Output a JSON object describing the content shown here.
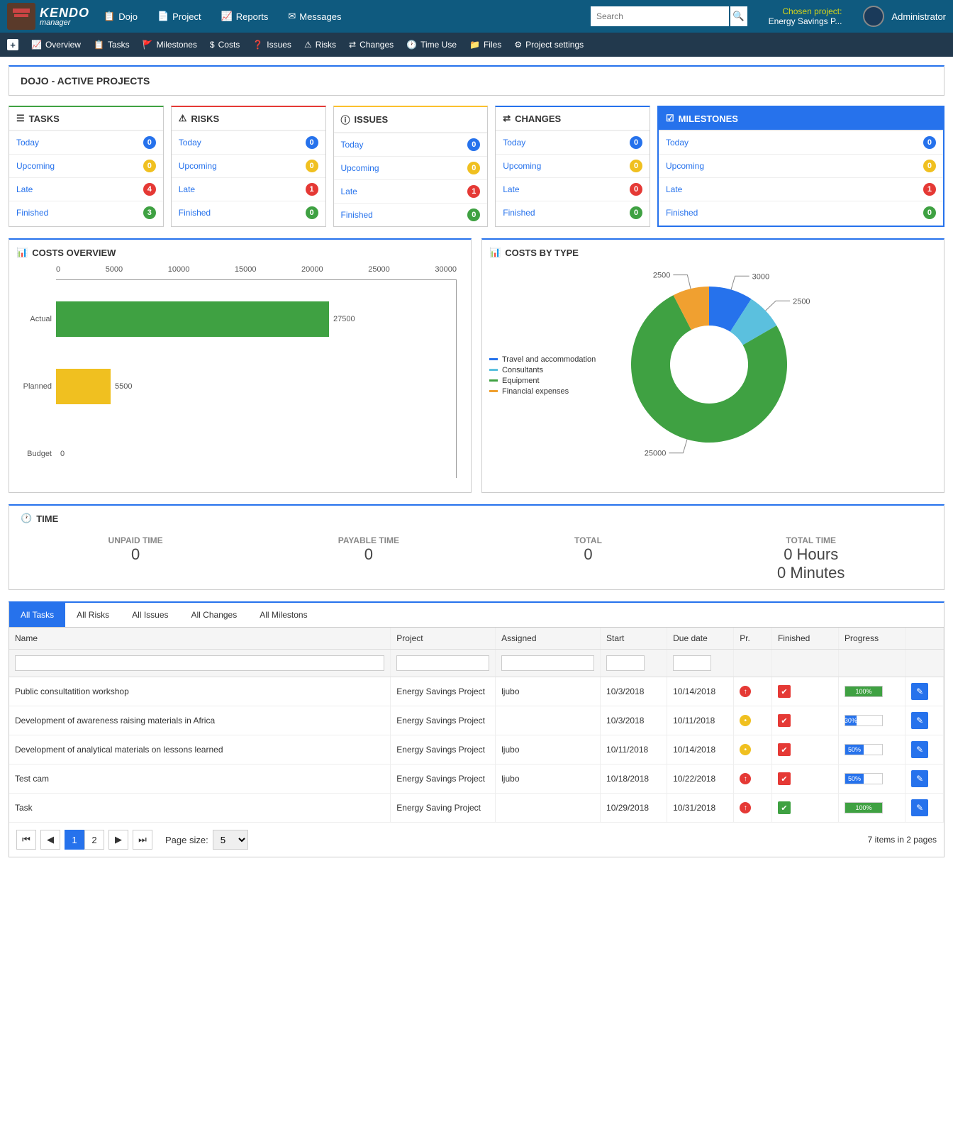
{
  "brand": {
    "name": "KENDO",
    "subtitle": "manager"
  },
  "topnav": [
    "Dojo",
    "Project",
    "Reports",
    "Messages"
  ],
  "search": {
    "placeholder": "Search"
  },
  "chosen": {
    "label": "Chosen project:",
    "value": "Energy Savings P..."
  },
  "user": "Administrator",
  "subnav": [
    "Overview",
    "Tasks",
    "Milestones",
    "Costs",
    "Issues",
    "Risks",
    "Changes",
    "Time Use",
    "Files",
    "Project settings"
  ],
  "page_title": "DOJO - ACTIVE PROJECTS",
  "widgets": [
    {
      "title": "TASKS",
      "color": "green",
      "rows": [
        {
          "label": "Today",
          "count": 0,
          "style": "zero"
        },
        {
          "label": "Upcoming",
          "count": 0,
          "style": "ywarn"
        },
        {
          "label": "Late",
          "count": 4,
          "style": "rlate"
        },
        {
          "label": "Finished",
          "count": 3,
          "style": "gdone"
        }
      ]
    },
    {
      "title": "RISKS",
      "color": "red",
      "rows": [
        {
          "label": "Today",
          "count": 0,
          "style": "zero"
        },
        {
          "label": "Upcoming",
          "count": 0,
          "style": "ywarn"
        },
        {
          "label": "Late",
          "count": 1,
          "style": "rlate"
        },
        {
          "label": "Finished",
          "count": 0,
          "style": "gdone"
        }
      ]
    },
    {
      "title": "ISSUES",
      "color": "yellow",
      "rows": [
        {
          "label": "Today",
          "count": 0,
          "style": "zero"
        },
        {
          "label": "Upcoming",
          "count": 0,
          "style": "ywarn"
        },
        {
          "label": "Late",
          "count": 1,
          "style": "rlate"
        },
        {
          "label": "Finished",
          "count": 0,
          "style": "gdone"
        }
      ]
    },
    {
      "title": "CHANGES",
      "color": "blue",
      "rows": [
        {
          "label": "Today",
          "count": 0,
          "style": "zero"
        },
        {
          "label": "Upcoming",
          "count": 0,
          "style": "ywarn"
        },
        {
          "label": "Late",
          "count": 0,
          "style": "rlate"
        },
        {
          "label": "Finished",
          "count": 0,
          "style": "gdone"
        }
      ]
    },
    {
      "title": "MILESTONES",
      "color": "milestones",
      "rows": [
        {
          "label": "Today",
          "count": 0,
          "style": "zero"
        },
        {
          "label": "Upcoming",
          "count": 0,
          "style": "ywarn"
        },
        {
          "label": "Late",
          "count": 1,
          "style": "rlate"
        },
        {
          "label": "Finished",
          "count": 0,
          "style": "gdone"
        }
      ]
    }
  ],
  "costs_overview": {
    "title": "COSTS OVERVIEW"
  },
  "costs_by_type": {
    "title": "COSTS BY TYPE"
  },
  "chart_data": [
    {
      "type": "bar",
      "orientation": "horizontal",
      "categories": [
        "Actual",
        "Planned",
        "Budget"
      ],
      "values": [
        27500,
        5500,
        0
      ],
      "colors": [
        "#3fa142",
        "#f0c020",
        "#e53935"
      ],
      "xticks": [
        0,
        5000,
        10000,
        15000,
        20000,
        25000,
        30000
      ],
      "xlim": [
        0,
        30000
      ]
    },
    {
      "type": "pie",
      "series": [
        {
          "name": "Travel and accommodation",
          "value": 3000,
          "color": "#2672ec"
        },
        {
          "name": "Consultants",
          "value": 2500,
          "color": "#5bc0de"
        },
        {
          "name": "Equipment",
          "value": 25000,
          "color": "#3fa142"
        },
        {
          "name": "Financial expenses",
          "value": 2500,
          "color": "#f0a030"
        }
      ]
    }
  ],
  "time": {
    "title": "TIME",
    "stats": [
      {
        "label": "UNPAID TIME",
        "value": "0"
      },
      {
        "label": "PAYABLE TIME",
        "value": "0"
      },
      {
        "label": "TOTAL",
        "value": "0"
      },
      {
        "label": "TOTAL TIME",
        "value": "0 Hours\n0 Minutes"
      }
    ]
  },
  "tabs": [
    "All Tasks",
    "All Risks",
    "All Issues",
    "All Changes",
    "All Milestons"
  ],
  "grid": {
    "columns": [
      "Name",
      "Project",
      "Assigned",
      "Start",
      "Due date",
      "Pr.",
      "Finished",
      "Progress",
      ""
    ],
    "rows": [
      {
        "name": "Public consultatition workshop",
        "project": "Energy Savings Project",
        "assigned": "ljubo",
        "start": "10/3/2018",
        "due": "10/14/2018",
        "pr": "up",
        "finished": false,
        "progress": 100,
        "pcolor": "green"
      },
      {
        "name": "Development of awareness raising materials in Africa",
        "project": "Energy Savings Project",
        "assigned": "",
        "start": "10/3/2018",
        "due": "10/11/2018",
        "pr": "mid",
        "finished": false,
        "progress": 30,
        "pcolor": "blue"
      },
      {
        "name": "Development of analytical materials on lessons learned",
        "project": "Energy Savings Project",
        "assigned": "ljubo",
        "start": "10/11/2018",
        "due": "10/14/2018",
        "pr": "mid",
        "finished": false,
        "progress": 50,
        "pcolor": "blue"
      },
      {
        "name": "Test cam",
        "project": "Energy Savings Project",
        "assigned": "ljubo",
        "start": "10/18/2018",
        "due": "10/22/2018",
        "pr": "up",
        "finished": false,
        "progress": 50,
        "pcolor": "blue"
      },
      {
        "name": "Task",
        "project": "Energy Saving Project",
        "assigned": "",
        "start": "10/29/2018",
        "due": "10/31/2018",
        "pr": "up",
        "finished": true,
        "progress": 100,
        "pcolor": "green"
      }
    ]
  },
  "pager": {
    "pages": [
      "1",
      "2"
    ],
    "page_size_label": "Page size:",
    "page_size": "5",
    "summary": "7 items in 2 pages"
  }
}
